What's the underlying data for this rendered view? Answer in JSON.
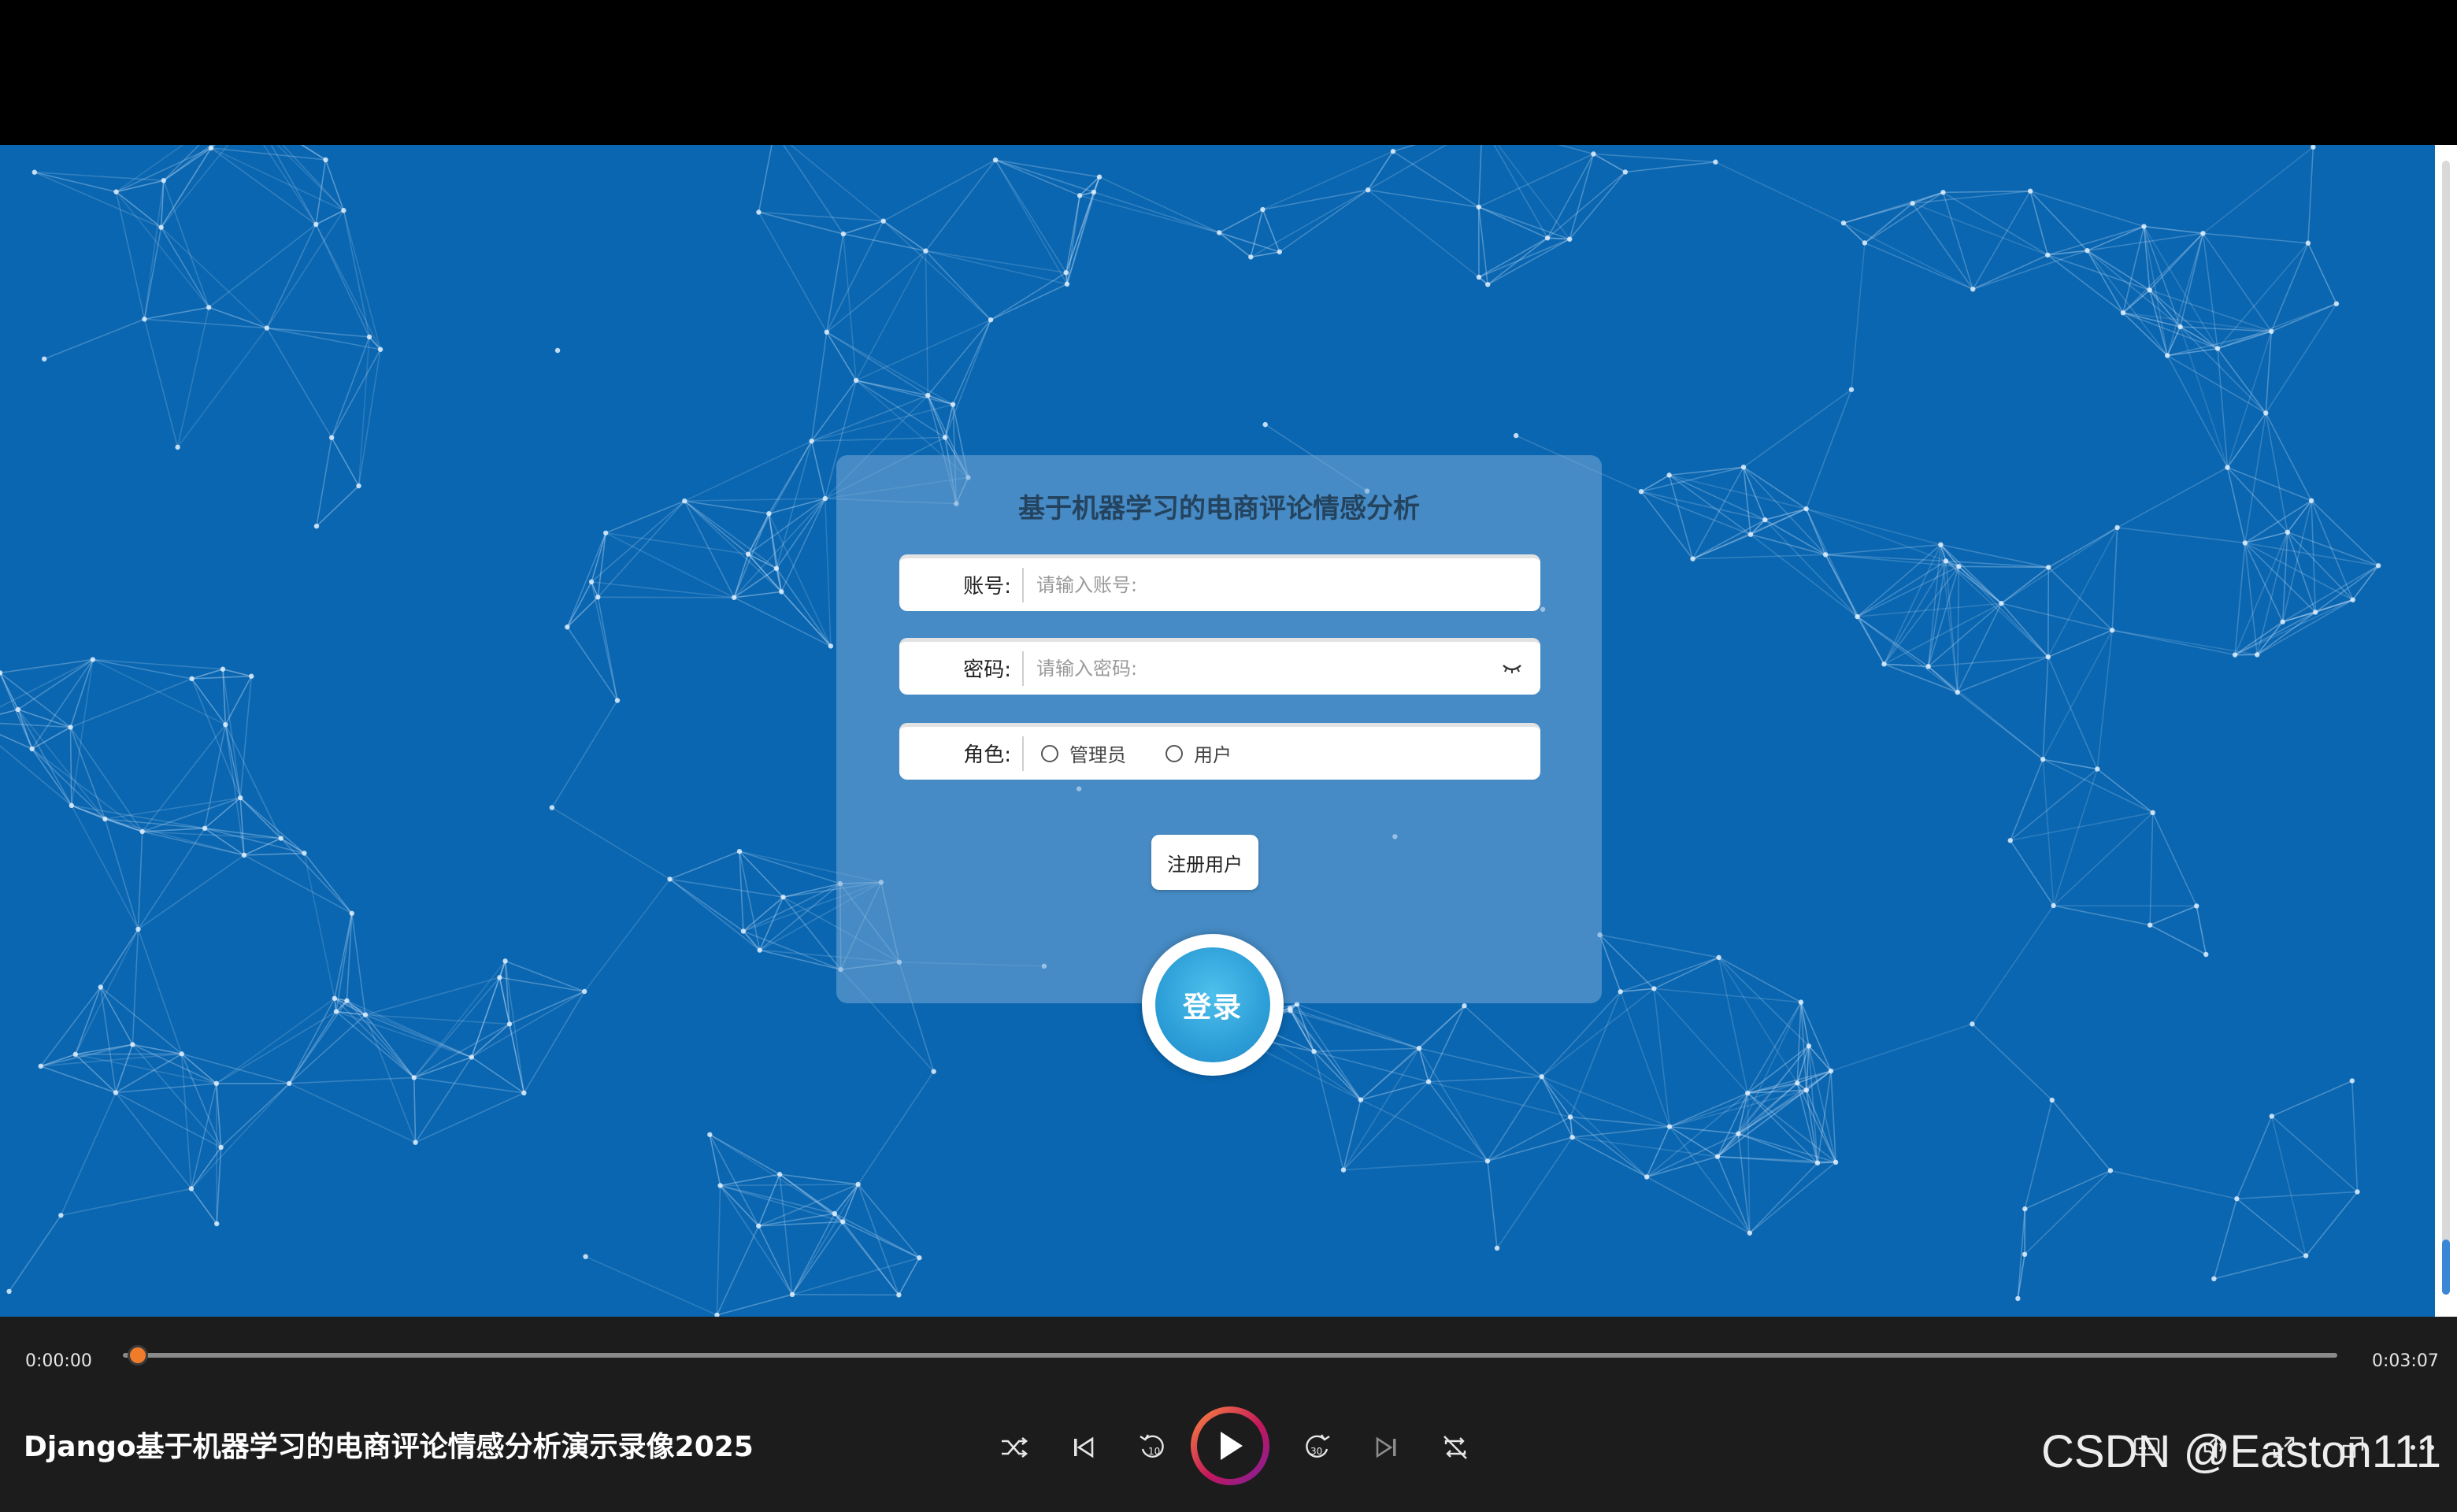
{
  "login": {
    "title": "基于机器学习的电商评论情感分析",
    "account_label": "账号:",
    "account_placeholder": "请输入账号:",
    "password_label": "密码:",
    "password_placeholder": "请输入密码:",
    "role_label": "角色:",
    "roles": [
      {
        "label": "管理员",
        "selected": false
      },
      {
        "label": "用户",
        "selected": false
      }
    ],
    "register_label": "注册用户",
    "login_label": "登录"
  },
  "player": {
    "current_time": "0:00:00",
    "total_time": "0:03:07",
    "progress": 0,
    "video_title": "Django基于机器学习的电商评论情感分析演示录像2025",
    "buttons": [
      "shuffle-icon",
      "previous-icon",
      "rewind-10-icon",
      "play-icon",
      "forward-30-icon",
      "next-icon",
      "repeat-off-icon",
      "subtitles-icon",
      "volume-icon",
      "fullscreen-icon",
      "mini-player-icon",
      "more-icon"
    ]
  },
  "watermark": "CSDN @Easton111",
  "colors": {
    "background": "#0a66b0",
    "accent": "#f07c2a",
    "login_button": "#2d9fd8"
  }
}
